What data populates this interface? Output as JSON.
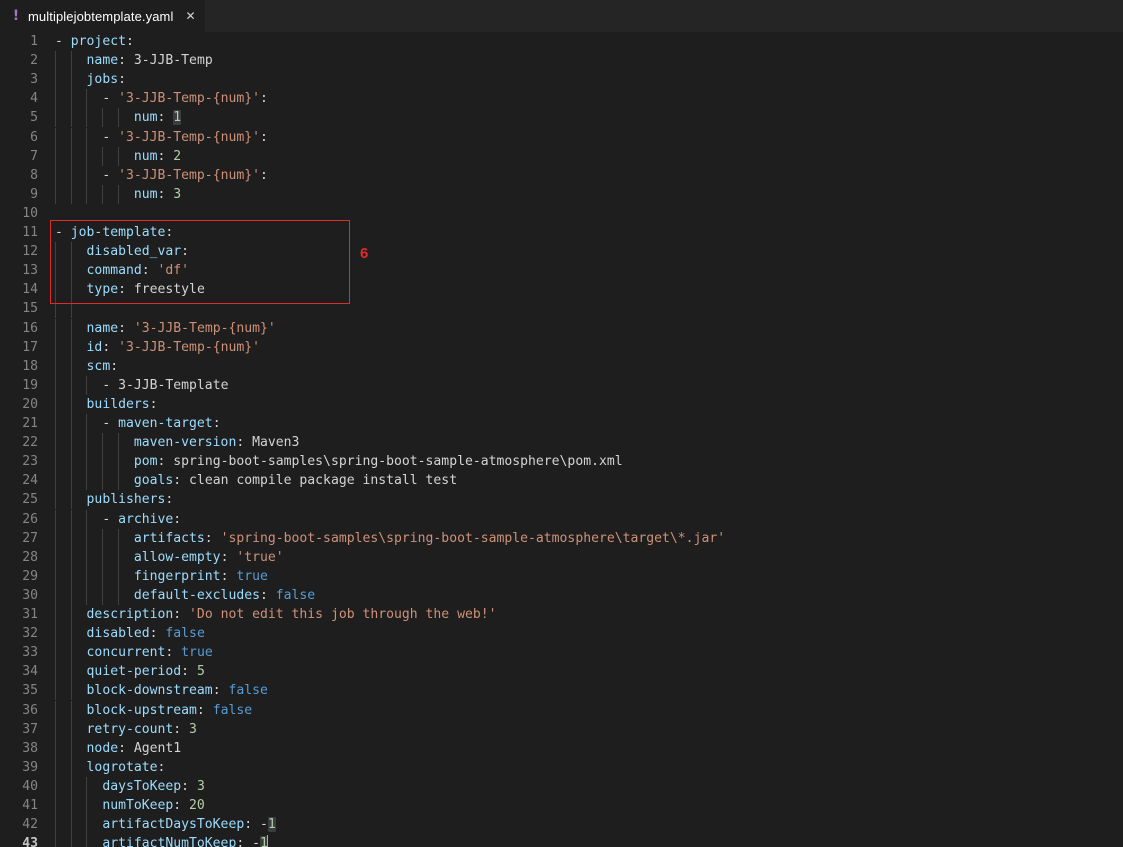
{
  "window": {
    "background": "#1e1e1e",
    "tabbar_background": "#252526"
  },
  "tab": {
    "icon": "yaml-exclamation-icon",
    "icon_glyph": "!",
    "icon_color": "#a074c4",
    "filename": "multiplejobtemplate.yaml",
    "close_glyph": "✕"
  },
  "editor": {
    "language": "yaml",
    "active_line": 43,
    "theme_colors": {
      "key": "#9cdcfe",
      "string": "#ce9178",
      "number": "#b5cea8",
      "boolean": "#569cd6",
      "plain": "#d4d4d4",
      "line_number": "#858585",
      "active_line_number": "#c6c6c6",
      "indent_guide": "#404040",
      "selection_match": "#3a3d41"
    },
    "lines": [
      {
        "n": 1,
        "text": "- project:"
      },
      {
        "n": 2,
        "text": "    name: 3-JJB-Temp"
      },
      {
        "n": 3,
        "text": "    jobs:"
      },
      {
        "n": 4,
        "text": "      - '3-JJB-Temp-{num}':"
      },
      {
        "n": 5,
        "text": "          num: 1"
      },
      {
        "n": 6,
        "text": "      - '3-JJB-Temp-{num}':"
      },
      {
        "n": 7,
        "text": "          num: 2"
      },
      {
        "n": 8,
        "text": "      - '3-JJB-Temp-{num}':"
      },
      {
        "n": 9,
        "text": "          num: 3"
      },
      {
        "n": 10,
        "text": ""
      },
      {
        "n": 11,
        "text": "- job-template:"
      },
      {
        "n": 12,
        "text": "    disabled_var:"
      },
      {
        "n": 13,
        "text": "    command: 'df'"
      },
      {
        "n": 14,
        "text": "    type: freestyle"
      },
      {
        "n": 15,
        "text": ""
      },
      {
        "n": 16,
        "text": "    name: '3-JJB-Temp-{num}'"
      },
      {
        "n": 17,
        "text": "    id: '3-JJB-Temp-{num}'"
      },
      {
        "n": 18,
        "text": "    scm:"
      },
      {
        "n": 19,
        "text": "      - 3-JJB-Template"
      },
      {
        "n": 20,
        "text": "    builders:"
      },
      {
        "n": 21,
        "text": "      - maven-target:"
      },
      {
        "n": 22,
        "text": "          maven-version: Maven3"
      },
      {
        "n": 23,
        "text": "          pom: spring-boot-samples\\spring-boot-sample-atmosphere\\pom.xml"
      },
      {
        "n": 24,
        "text": "          goals: clean compile package install test"
      },
      {
        "n": 25,
        "text": "    publishers:"
      },
      {
        "n": 26,
        "text": "      - archive:"
      },
      {
        "n": 27,
        "text": "          artifacts: 'spring-boot-samples\\spring-boot-sample-atmosphere\\target\\*.jar'"
      },
      {
        "n": 28,
        "text": "          allow-empty: 'true'"
      },
      {
        "n": 29,
        "text": "          fingerprint: true"
      },
      {
        "n": 30,
        "text": "          default-excludes: false"
      },
      {
        "n": 31,
        "text": "    description: 'Do not edit this job through the web!'"
      },
      {
        "n": 32,
        "text": "    disabled: false"
      },
      {
        "n": 33,
        "text": "    concurrent: true"
      },
      {
        "n": 34,
        "text": "    quiet-period: 5"
      },
      {
        "n": 35,
        "text": "    block-downstream: false"
      },
      {
        "n": 36,
        "text": "    block-upstream: false"
      },
      {
        "n": 37,
        "text": "    retry-count: 3"
      },
      {
        "n": 38,
        "text": "    node: Agent1"
      },
      {
        "n": 39,
        "text": "    logrotate:"
      },
      {
        "n": 40,
        "text": "      daysToKeep: 3"
      },
      {
        "n": 41,
        "text": "      numToKeep: 20"
      },
      {
        "n": 42,
        "text": "      artifactDaysToKeep: -1"
      },
      {
        "n": 43,
        "text": "      artifactNumToKeep: -1"
      }
    ]
  },
  "annotation": {
    "label": "6",
    "color": "#e02b2b",
    "covers_lines": "11-14"
  }
}
